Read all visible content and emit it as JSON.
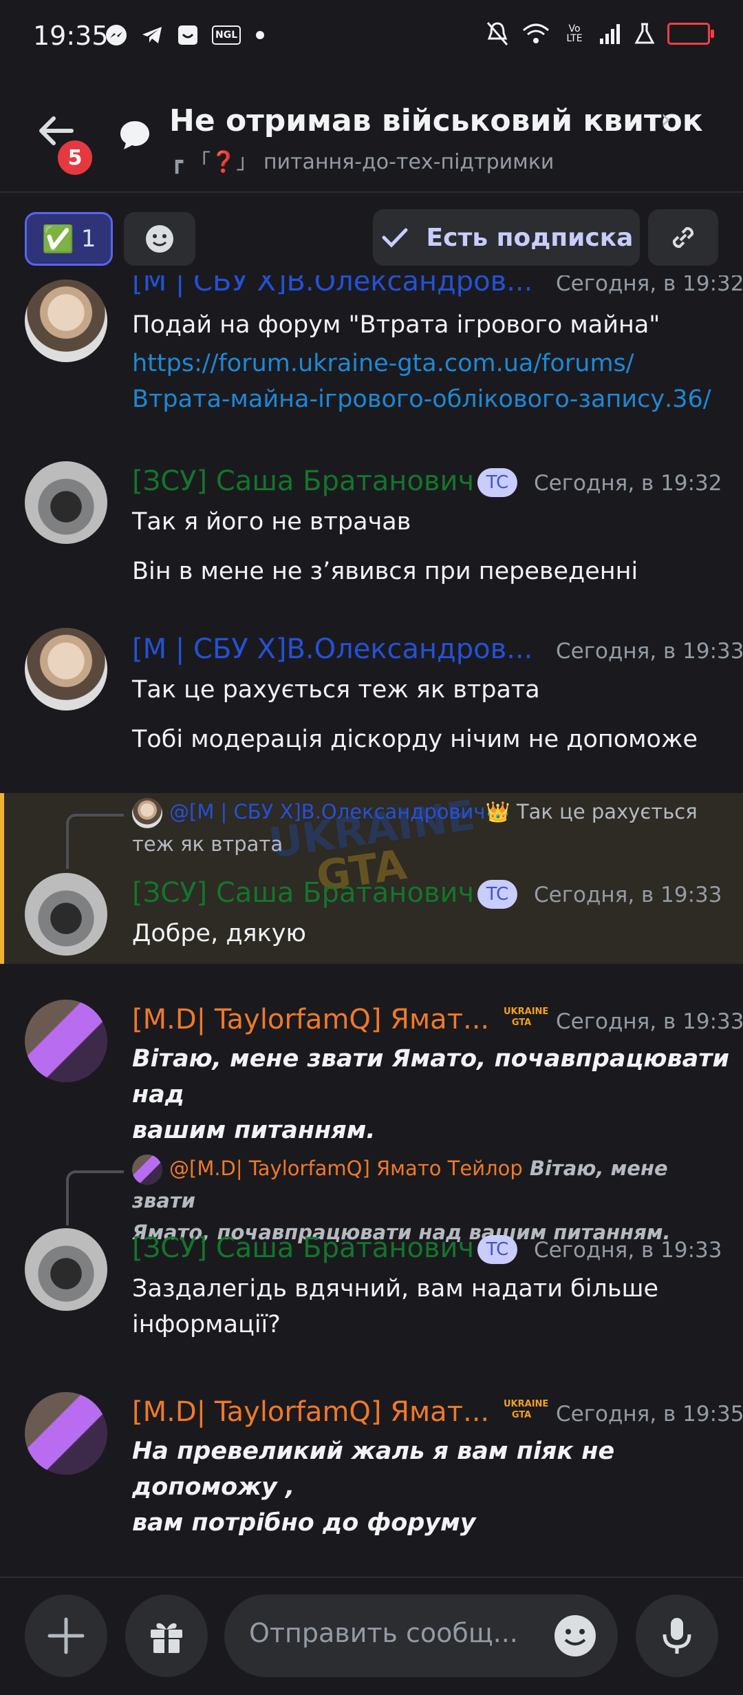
{
  "status_bar": {
    "time": "19:35",
    "left_icons": [
      "messenger-icon",
      "telegram-icon",
      "chat-icon",
      "ngl-icon",
      "dot-icon"
    ],
    "ngl": "NGL",
    "network": "Vo LTE"
  },
  "header": {
    "back_badge": "5",
    "title": "Не отримав військовий квиток",
    "subtitle_prefix": "「❓」",
    "subtitle": "питання-до-тех-підтримки"
  },
  "actions": {
    "reaction_emoji": "✅",
    "reaction_count": "1",
    "subscribe_label": "Есть подписка"
  },
  "messages": [
    {
      "author": "[M | СБУ X]В.Олександров...",
      "time": "Сегодня, в 19:32",
      "lines": [
        "Подай на форум \"Втрата ігрового майна\""
      ],
      "link_lines": [
        "https://forum.ukraine-gta.com.ua/forums/",
        "Втрата-майна-ігрового-облікового-запису.36/"
      ]
    },
    {
      "author": "[ЗСУ] Саша Братанович",
      "tag": "TC",
      "time": "Сегодня, в 19:32",
      "lines": [
        "Так я його не втрачав",
        "Він в мене не з’явився при переведенні"
      ]
    },
    {
      "author": "[M | СБУ X]В.Олександров...",
      "time": "Сегодня, в 19:33",
      "lines": [
        "Так це рахується теж як втрата",
        "Тобі модерація діскорду нічим не допоможе"
      ]
    },
    {
      "reply_author": "@[M | СБУ X]В.Олександрович",
      "reply_emoji": "👑",
      "reply_text_1": " Так це рахується",
      "reply_text_2": "теж як втрата",
      "author": "[ЗСУ] Саша Братанович",
      "tag": "TC",
      "time": "Сегодня, в 19:33",
      "lines": [
        "Добре, дякую"
      ],
      "watermark_1": "UKRAINE",
      "watermark_2": "GTA"
    },
    {
      "author": "[M.D| TaylorfamQ] Ямат...",
      "logo": "UKRAINE GTA",
      "time": "Сегодня, в 19:33",
      "lines": [
        "Вітаю, мене звати Ямато, почавпрацювати над",
        "вашим питанням."
      ]
    },
    {
      "reply_author": "@[M.D| TaylorfamQ] Ямато Тейлор",
      "reply_text_1": " Вітаю, мене звати",
      "reply_text_2": "Ямато, почавпрацювати над вашим питанням.",
      "author": "[ЗСУ] Саша Братанович",
      "tag": "TC",
      "time": "Сегодня, в 19:33",
      "lines": [
        "Заздалегідь вдячний, вам надати більше",
        "інформації?"
      ]
    },
    {
      "author": "[M.D| TaylorfamQ] Ямат...",
      "logo": "UKRAINE GTA",
      "time": "Сегодня, в 19:35",
      "lines": [
        "На превеликий жаль я вам піяк не допоможу ,",
        "вам потрібно до форуму"
      ]
    }
  ],
  "composer": {
    "placeholder": "Отправить сообщ..."
  }
}
